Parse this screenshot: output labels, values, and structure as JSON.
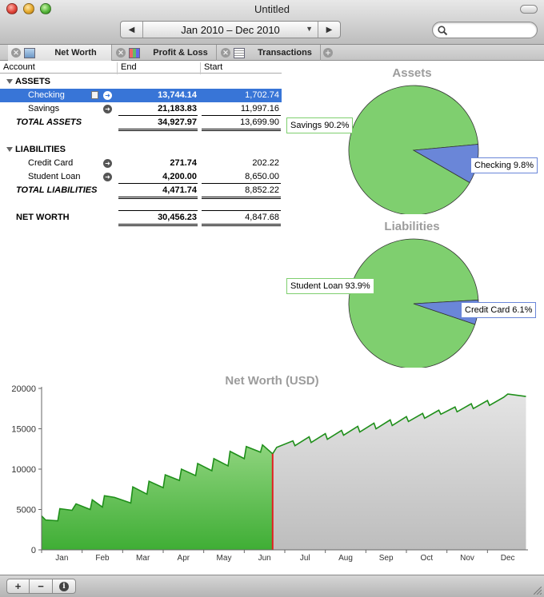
{
  "window": {
    "title": "Untitled"
  },
  "toolbar": {
    "prev_label": "◀",
    "next_label": "▶",
    "date_range": "Jan 2010 – Dec 2010",
    "caret": "▼",
    "search_placeholder": ""
  },
  "tabs": [
    {
      "label": "Net Worth",
      "active": true
    },
    {
      "label": "Profit & Loss",
      "active": false
    },
    {
      "label": "Transactions",
      "active": false
    }
  ],
  "table": {
    "headers": {
      "account": "Account",
      "end": "End",
      "start": "Start"
    },
    "assets": {
      "heading": "ASSETS",
      "rows": [
        {
          "name": "Checking",
          "end": "13,744.14",
          "start": "1,702.74",
          "selected": true
        },
        {
          "name": "Savings",
          "end": "21,183.83",
          "start": "11,997.16"
        }
      ],
      "total": {
        "name": "TOTAL ASSETS",
        "end": "34,927.97",
        "start": "13,699.90"
      }
    },
    "liabilities": {
      "heading": "LIABILITIES",
      "rows": [
        {
          "name": "Credit Card",
          "end": "271.74",
          "start": "202.22"
        },
        {
          "name": "Student Loan",
          "end": "4,200.00",
          "start": "8,650.00"
        }
      ],
      "total": {
        "name": "TOTAL LIABILITIES",
        "end": "4,471.74",
        "start": "8,852.22"
      }
    },
    "net_worth": {
      "name": "NET WORTH",
      "end": "30,456.23",
      "start": "4,847.68"
    }
  },
  "colors": {
    "selection": "#3875d7",
    "pie_green": "#7fcf6f",
    "pie_blue": "#6a86d8",
    "area_green": "#5fbf4f",
    "area_gray": "#d2d2d2",
    "today_line": "#e02020"
  },
  "chart_data": [
    {
      "type": "pie",
      "title": "Assets",
      "slices": [
        {
          "label": "Savings 90.2%",
          "value": 90.2,
          "color": "green"
        },
        {
          "label": "Checking 9.8%",
          "value": 9.8,
          "color": "blue"
        }
      ]
    },
    {
      "type": "pie",
      "title": "Liabilities",
      "slices": [
        {
          "label": "Student Loan 93.9%",
          "value": 93.9,
          "color": "green"
        },
        {
          "label": "Credit Card 6.1%",
          "value": 6.1,
          "color": "blue"
        }
      ]
    },
    {
      "type": "area",
      "title": "Net Worth (USD)",
      "categories": [
        "Jan",
        "Feb",
        "Mar",
        "Apr",
        "May",
        "Jun",
        "Jul",
        "Aug",
        "Sep",
        "Oct",
        "Nov",
        "Dec"
      ],
      "yticks": [
        0,
        5000,
        10000,
        15000,
        20000
      ],
      "ylim": [
        0,
        20000
      ],
      "current_month_index": 5.7,
      "x": [
        0,
        0.1,
        0.4,
        0.45,
        0.75,
        0.8,
        0.85,
        1.2,
        1.25,
        1.5,
        1.55,
        1.8,
        2.2,
        2.25,
        2.6,
        2.65,
        3.0,
        3.05,
        3.4,
        3.45,
        3.8,
        3.85,
        4.2,
        4.25,
        4.6,
        4.65,
        5.0,
        5.05,
        5.4,
        5.45,
        5.7,
        5.8,
        6.2,
        6.25,
        6.6,
        6.65,
        7.0,
        7.05,
        7.4,
        7.45,
        7.8,
        7.85,
        8.2,
        8.25,
        8.6,
        8.65,
        9.0,
        9.05,
        9.4,
        9.45,
        9.8,
        9.85,
        10.2,
        10.25,
        10.6,
        10.65,
        11.0,
        11.05,
        11.4,
        11.5,
        11.95
      ],
      "y": [
        4200,
        3700,
        3600,
        5100,
        4900,
        5300,
        5700,
        5000,
        6200,
        5300,
        6700,
        6500,
        5800,
        7800,
        6900,
        8500,
        7700,
        9300,
        8600,
        10000,
        9200,
        10700,
        9800,
        11300,
        10400,
        12200,
        11300,
        12800,
        12100,
        13000,
        11900,
        12700,
        13500,
        12900,
        14000,
        13300,
        14400,
        13700,
        14800,
        14200,
        15300,
        14600,
        15700,
        15000,
        16100,
        15400,
        16500,
        15900,
        16900,
        16300,
        17300,
        16800,
        17700,
        17100,
        18100,
        17500,
        18500,
        17900,
        18900,
        19300,
        19000
      ]
    }
  ]
}
